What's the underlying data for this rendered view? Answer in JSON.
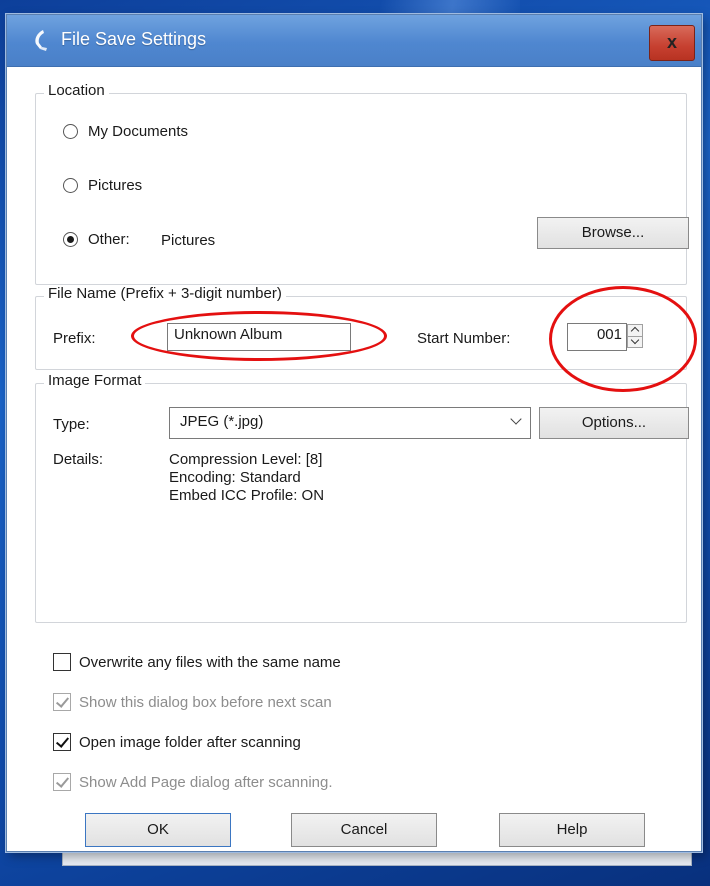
{
  "window": {
    "title": "File Save Settings",
    "close_label": "x"
  },
  "location": {
    "group_label": "Location",
    "options": [
      {
        "label": "My Documents",
        "checked": false
      },
      {
        "label": "Pictures",
        "checked": false
      },
      {
        "label": "Other:",
        "checked": true
      }
    ],
    "other_value": "Pictures",
    "browse_label": "Browse..."
  },
  "file_name": {
    "group_label": "File Name (Prefix + 3-digit number)",
    "prefix_label": "Prefix:",
    "prefix_value": "Unknown Album",
    "start_number_label": "Start Number:",
    "start_number_value": "001"
  },
  "image_format": {
    "group_label": "Image Format",
    "type_label": "Type:",
    "type_value": "JPEG (*.jpg)",
    "options_label": "Options...",
    "details_label": "Details:",
    "details": [
      "Compression Level: [8]",
      "Encoding: Standard",
      "Embed ICC Profile: ON"
    ]
  },
  "checkboxes": [
    {
      "label": "Overwrite any files with the same name",
      "checked": false,
      "enabled": true
    },
    {
      "label": "Show this dialog box before next scan",
      "checked": true,
      "enabled": false
    },
    {
      "label": "Open image folder after scanning",
      "checked": true,
      "enabled": true
    },
    {
      "label": "Show Add Page dialog after scanning.",
      "checked": true,
      "enabled": false
    }
  ],
  "buttons": {
    "ok": "OK",
    "cancel": "Cancel",
    "help": "Help"
  },
  "colors": {
    "title_bar": "#4f87d0",
    "close_button": "#c64030",
    "annotation": "#e41010"
  }
}
